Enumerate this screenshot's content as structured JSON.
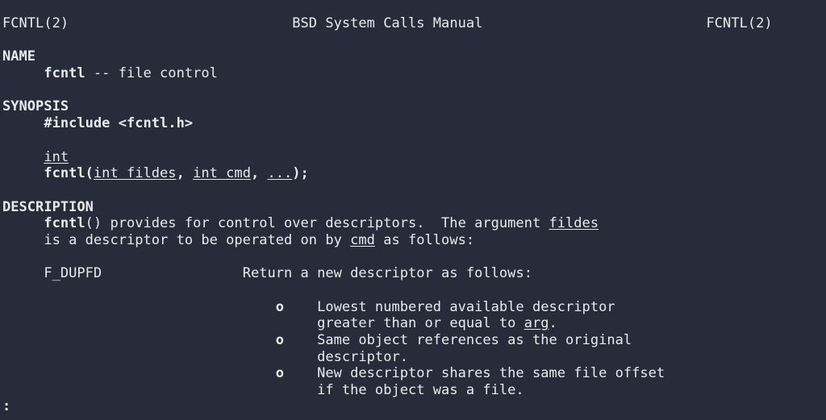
{
  "terminal": {
    "background_color": "#282c3a",
    "foreground_color": "#e9eaee",
    "columns": 96,
    "rows": 25
  },
  "pager": {
    "prompt": ":"
  },
  "manpage": {
    "header": {
      "left": "FCNTL(2)",
      "center": "BSD System Calls Manual",
      "right": "FCNTL(2)"
    },
    "sections": [
      {
        "heading": "NAME",
        "lines": [
          {
            "indent": 5,
            "spans": [
              {
                "text": "fcntl",
                "style": "bold"
              },
              {
                "text": " -- file control",
                "style": "normal"
              }
            ]
          }
        ]
      },
      {
        "heading": "SYNOPSIS",
        "lines": [
          {
            "indent": 5,
            "spans": [
              {
                "text": "#include <fcntl.h>",
                "style": "bold"
              }
            ]
          },
          {
            "indent": 0,
            "spans": []
          },
          {
            "indent": 5,
            "spans": [
              {
                "text": "int",
                "style": "underline"
              }
            ]
          },
          {
            "indent": 5,
            "spans": [
              {
                "text": "fcntl(",
                "style": "bold"
              },
              {
                "text": "int fildes",
                "style": "underline"
              },
              {
                "text": ", ",
                "style": "bold"
              },
              {
                "text": "int cmd",
                "style": "underline"
              },
              {
                "text": ", ",
                "style": "bold"
              },
              {
                "text": "...",
                "style": "underline"
              },
              {
                "text": ");",
                "style": "bold"
              }
            ]
          }
        ]
      },
      {
        "heading": "DESCRIPTION",
        "lines": [
          {
            "indent": 5,
            "spans": [
              {
                "text": "fcntl",
                "style": "bold"
              },
              {
                "text": "() provides for control over descriptors.  The argument ",
                "style": "normal"
              },
              {
                "text": "fildes",
                "style": "underline"
              }
            ]
          },
          {
            "indent": 5,
            "spans": [
              {
                "text": "is a descriptor to be operated on by ",
                "style": "normal"
              },
              {
                "text": "cmd",
                "style": "underline"
              },
              {
                "text": " as follows:",
                "style": "normal"
              }
            ]
          },
          {
            "indent": 0,
            "spans": []
          },
          {
            "indent": 5,
            "spans": [
              {
                "text": "F_DUPFD",
                "style": "normal"
              },
              {
                "text": "                 ",
                "style": "normal"
              },
              {
                "text": "Return a new descriptor as follows:",
                "style": "normal"
              }
            ]
          },
          {
            "indent": 0,
            "spans": []
          },
          {
            "indent": 33,
            "spans": [
              {
                "text": "o",
                "style": "bold"
              },
              {
                "text": "    Lowest numbered available descriptor",
                "style": "normal"
              }
            ]
          },
          {
            "indent": 38,
            "spans": [
              {
                "text": "greater than or equal to ",
                "style": "normal"
              },
              {
                "text": "arg",
                "style": "underline"
              },
              {
                "text": ".",
                "style": "normal"
              }
            ]
          },
          {
            "indent": 33,
            "spans": [
              {
                "text": "o",
                "style": "bold"
              },
              {
                "text": "    Same object references as the original",
                "style": "normal"
              }
            ]
          },
          {
            "indent": 38,
            "spans": [
              {
                "text": "descriptor.",
                "style": "normal"
              }
            ]
          },
          {
            "indent": 33,
            "spans": [
              {
                "text": "o",
                "style": "bold"
              },
              {
                "text": "    New descriptor shares the same file offset",
                "style": "normal"
              }
            ]
          },
          {
            "indent": 38,
            "spans": [
              {
                "text": "if the object was a file.",
                "style": "normal"
              }
            ]
          }
        ]
      }
    ]
  }
}
